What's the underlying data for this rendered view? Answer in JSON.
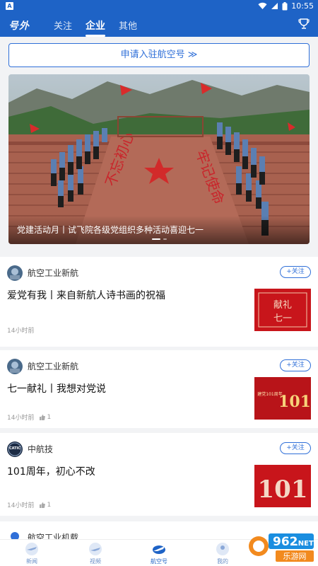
{
  "status_bar": {
    "badge": "A",
    "time": "10:55"
  },
  "topnav": {
    "logo": "号外",
    "tabs": [
      {
        "label": "关注"
      },
      {
        "label": "企业"
      },
      {
        "label": "其他"
      }
    ],
    "active_tab": "企业"
  },
  "apply_button": {
    "label": "申请入驻航空号 ≫"
  },
  "banner": {
    "caption": "党建活动月丨试飞院各级党组织多种活动喜迎七一",
    "pages": 2,
    "active_page": 1
  },
  "feed": [
    {
      "source": "航空工业新航",
      "follow": "+关注",
      "headline": "爱党有我丨来自新航人诗书画的祝福",
      "time": "14小时前",
      "likes": "",
      "thumb": {
        "text_top": "献礼",
        "text_bottom": "七一"
      }
    },
    {
      "source": "航空工业新航",
      "follow": "+关注",
      "headline": "七一献礼丨我想对党说",
      "time": "14小时前",
      "likes": "1",
      "thumb": {
        "text_top": "建党101周年",
        "text_bottom": "101"
      }
    },
    {
      "source": "中航技",
      "avatar_text": "CATIC",
      "follow": "+关注",
      "headline": "101周年，初心不改",
      "time": "14小时前",
      "likes": "1",
      "thumb": {
        "text_top": "",
        "text_bottom": "101"
      }
    },
    {
      "source": "航空工业机载"
    }
  ],
  "tabbar": [
    {
      "label": "新闻"
    },
    {
      "label": "视频"
    },
    {
      "label": "航空号"
    },
    {
      "label": "我的"
    }
  ],
  "watermark": {
    "number": "962",
    "suffix": ".NET",
    "sub": "乐游网"
  },
  "colors": {
    "primary": "#1e63c6",
    "accent": "#2f6fd8",
    "thumb_red": "#c8151b"
  }
}
